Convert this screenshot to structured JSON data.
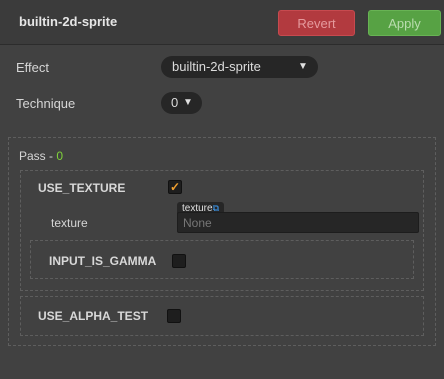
{
  "header": {
    "title": "builtin-2d-sprite",
    "revert_label": "Revert",
    "apply_label": "Apply"
  },
  "effect": {
    "label": "Effect",
    "value": "builtin-2d-sprite"
  },
  "technique": {
    "label": "Technique",
    "value": "0"
  },
  "pass": {
    "label": "Pass - ",
    "index": "0",
    "defines": {
      "use_texture": {
        "label": "USE_TEXTURE",
        "checked": true
      },
      "texture": {
        "label": "texture",
        "tag": "texture",
        "placeholder": "None"
      },
      "input_is_gamma": {
        "label": "INPUT_IS_GAMMA",
        "checked": false
      },
      "use_alpha_test": {
        "label": "USE_ALPHA_TEST",
        "checked": false
      }
    }
  },
  "icons": {
    "dropdown": "chevron-down-icon",
    "check": "checkmark-icon",
    "link": "external-link-icon"
  },
  "colors": {
    "revert": "#b23a3f",
    "apply": "#57a244",
    "pass_index": "#7fd23a",
    "check": "#f0a030"
  }
}
